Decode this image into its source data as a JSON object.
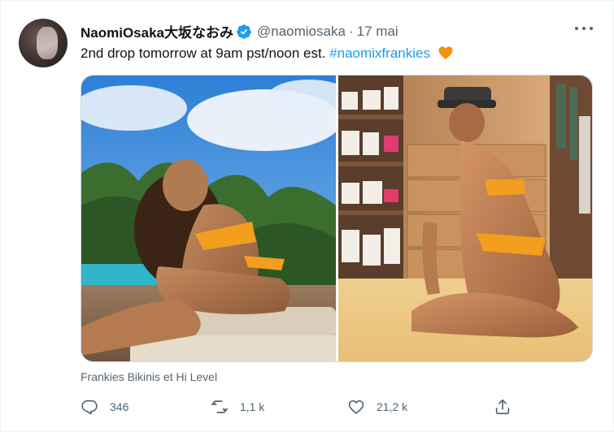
{
  "tweet": {
    "author_name": "NaomiOsaka大坂なおみ",
    "handle": "@naomiosaka",
    "separator": "·",
    "date": "17 mai",
    "text": "2nd drop tomorrow at 9am pst/noon est. ",
    "hashtag": "#naomixfrankies",
    "emoji": "orange-heart-icon",
    "media_caption": "Frankies Bikinis et Hi Level",
    "reply_count": "346",
    "retweet_count": "1,1 k",
    "like_count": "21,2 k"
  },
  "colors": {
    "link": "#1d9bf0",
    "secondary_text": "#536471",
    "verified": "#1d9bf0",
    "heart_emoji": "#f4900c",
    "border": "#cfd9de"
  },
  "icons": {
    "reply": "reply-icon",
    "retweet": "retweet-icon",
    "like": "heart-icon",
    "share": "share-icon",
    "more": "more-icon",
    "verified": "verified-badge-icon"
  }
}
